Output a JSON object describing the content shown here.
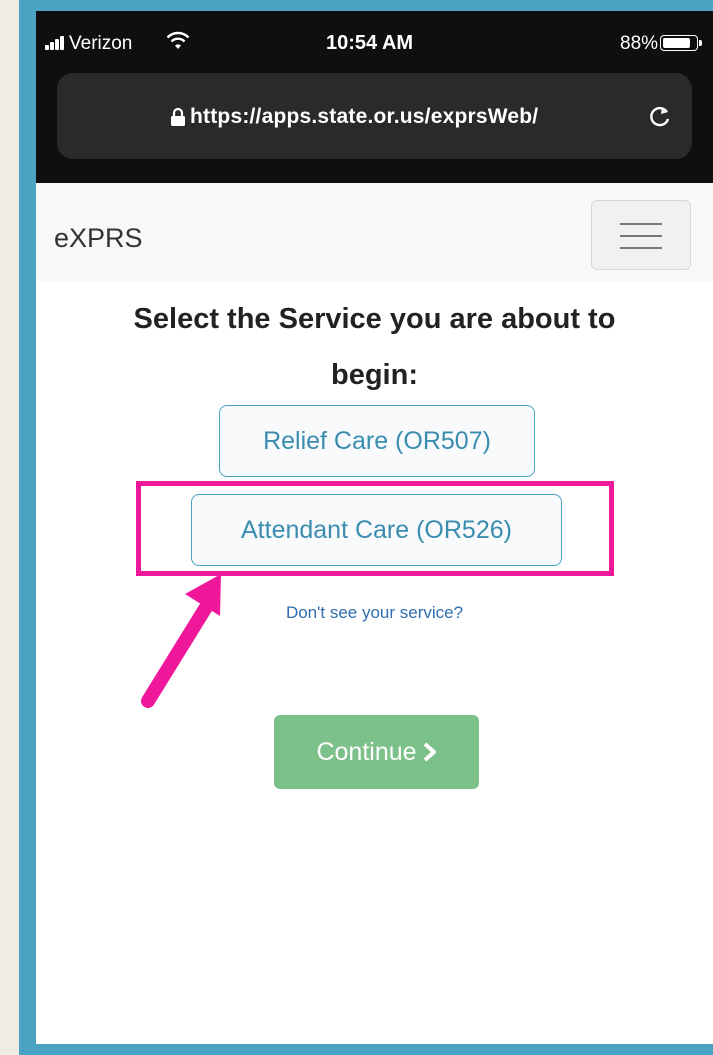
{
  "status_bar": {
    "carrier": "Verizon",
    "time": "10:54 AM",
    "battery": "88%"
  },
  "browser": {
    "url": "https://apps.state.or.us/exprsWeb/"
  },
  "navbar": {
    "brand": "eXPRS"
  },
  "main": {
    "heading_line1": "Select the Service you are about to",
    "heading_line2": "begin:",
    "services": [
      {
        "label": "Relief Care (OR507)"
      },
      {
        "label": "Attendant Care (OR526)"
      }
    ],
    "help_link": "Don't see your service?",
    "continue_label": "Continue"
  },
  "colors": {
    "highlight": "#f0189a",
    "continue_button": "#7dc18a",
    "frame": "#4aa3c3"
  }
}
